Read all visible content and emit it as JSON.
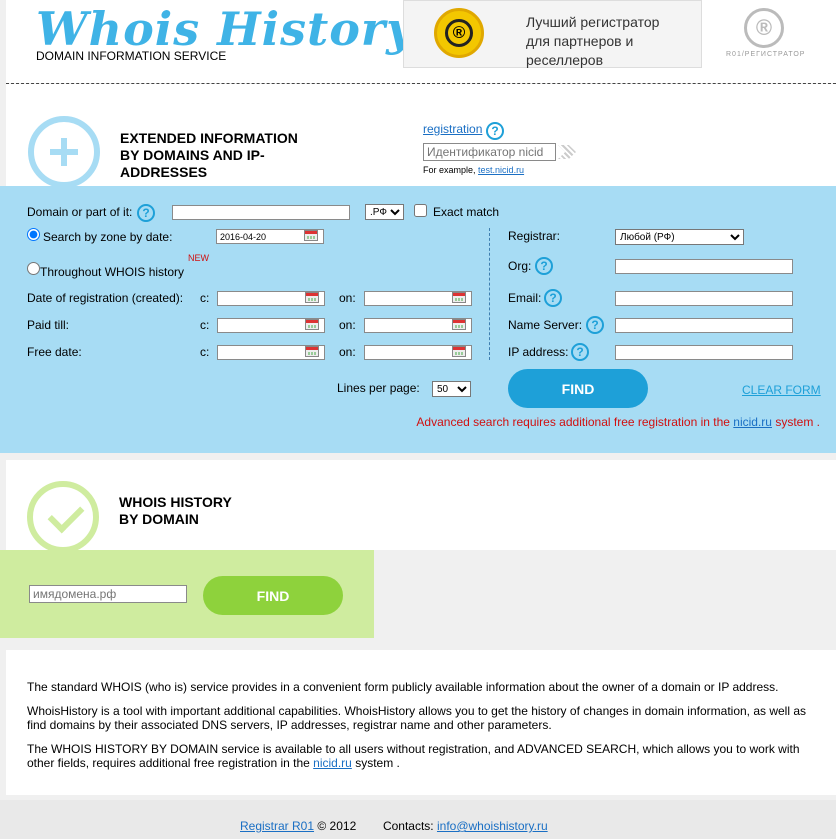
{
  "header": {
    "logo_text": "Whois History",
    "tagline": "DOMAIN INFORMATION SERVICE",
    "banner_text": "Лучший регистратор для партнеров и реселлеров",
    "r01_text": "R01/РЕГИСТРАТОР"
  },
  "extended": {
    "title_line1": "EXTENDED INFORMATION",
    "title_line2": "BY DOMAINS AND IP-",
    "title_line3": "ADDRESSES",
    "registration_link": "registration",
    "nicid_placeholder": "Идентификатор nicid",
    "example_prefix": "For example,",
    "example_link": "test.nicid.ru"
  },
  "form": {
    "domain_label": "Domain or part of it:",
    "zone_selected": ".РФ",
    "exact_match_label": "Exact match",
    "search_by_zone_label": "Search by zone by date:",
    "zone_date_value": "2016-04-20",
    "throughout_label": "Throughout WHOIS history",
    "new_badge": "NEW",
    "date_reg_label": "Date of registration (created):",
    "paid_till_label": "Paid till:",
    "free_date_label": "Free date:",
    "from_label": "c:",
    "on_label": "on:",
    "registrar_label": "Registrar:",
    "registrar_selected": "Любой (РФ)",
    "org_label": "Org:",
    "email_label": "Email:",
    "ns_label": "Name Server:",
    "ip_label": "IP address:",
    "lines_label": "Lines per page:",
    "lines_selected": "50",
    "find_label": "FIND",
    "clear_label": "CLEAR FORM",
    "notice_text": "Advanced search requires additional free registration in the",
    "notice_link": "nicid.ru",
    "notice_suffix": "system ."
  },
  "by_domain": {
    "title_line1": "WHOIS HISTORY",
    "title_line2": "BY DOMAIN",
    "placeholder": "имядомена.рф",
    "find_label": "FIND"
  },
  "info": {
    "p1": "The standard WHOIS (who is) service provides in a convenient form publicly available information about the owner of a domain or IP address.",
    "p2": "WhoisHistory is a tool with important additional capabilities. WhoisHistory allows you to get the history of changes in domain information, as well as find domains by their associated DNS servers, IP addresses, registrar name and other parameters.",
    "p3_text": "The WHOIS HISTORY BY DOMAIN service is available to all users without registration, and ADVANCED SEARCH, which allows you to work with other fields, requires additional free registration in the",
    "p3_link": "nicid.ru",
    "p3_suffix": "system ."
  },
  "footer": {
    "registrar_link": "Registrar R01",
    "copyright": "© 2012",
    "contacts_label": "Contacts:",
    "contacts_email": "info@whoishistory.ru"
  },
  "colors": {
    "blue_panel": "#a7dcf4",
    "accent_blue": "#1ea0d8",
    "green_panel": "#cfec9f",
    "accent_green": "#8ed23c",
    "notice_red": "#d01010"
  }
}
